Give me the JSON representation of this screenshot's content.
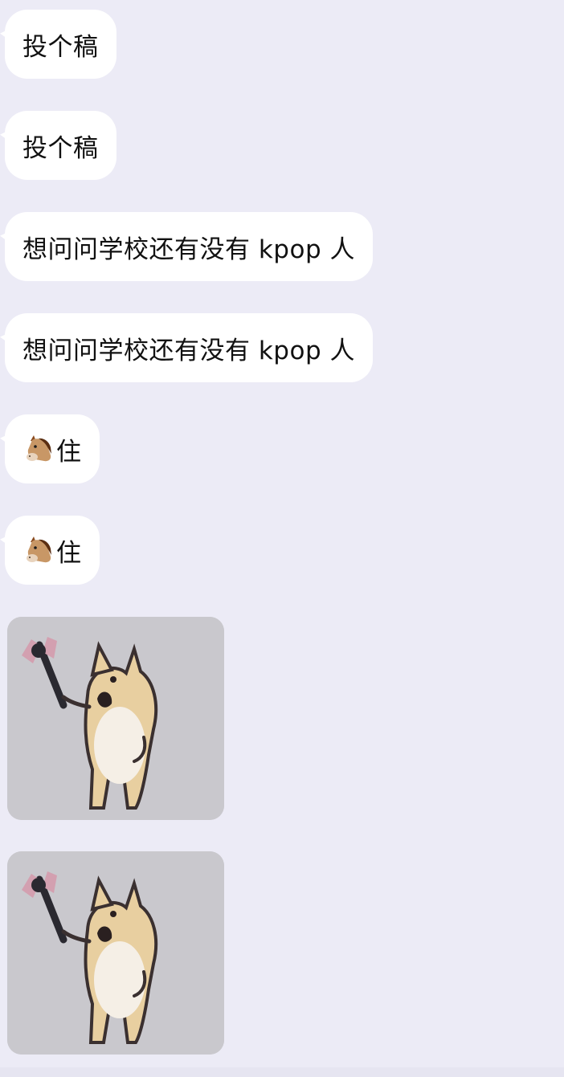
{
  "messages": [
    {
      "type": "text",
      "text": "投个稿"
    },
    {
      "type": "text",
      "text": "投个稿"
    },
    {
      "type": "text",
      "text": "想问问学校还有没有 kpop 人"
    },
    {
      "type": "text",
      "text": "想问问学校还有没有 kpop 人"
    },
    {
      "type": "text",
      "emoji": "horse-face-icon",
      "text": "住"
    },
    {
      "type": "text",
      "emoji": "horse-face-icon",
      "text": "住"
    },
    {
      "type": "sticker",
      "sticker": "doge-holding-hammer-sticker"
    },
    {
      "type": "sticker",
      "sticker": "doge-holding-hammer-sticker"
    }
  ],
  "colors": {
    "background": "#ecebf6",
    "bubble": "#ffffff",
    "text": "#111111",
    "sticker_bg": "#c9c8cd"
  }
}
